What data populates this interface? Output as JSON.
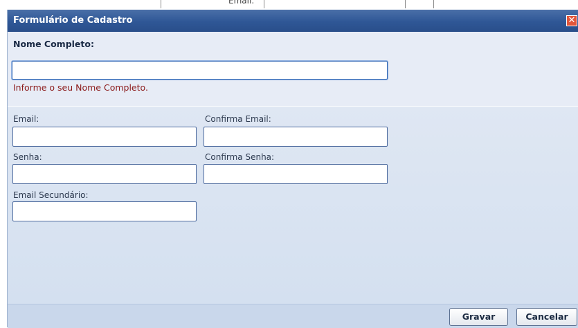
{
  "background_fragment": "Email:",
  "dialog": {
    "title": "Formulário de Cadastro",
    "close_glyph": "✕",
    "close_color": "#e2563b",
    "full_name": {
      "label": "Nome Completo:",
      "value": "",
      "error": "Informe o seu Nome Completo."
    },
    "email": {
      "label": "Email:",
      "value": ""
    },
    "confirm_email": {
      "label": "Confirma Email:",
      "value": ""
    },
    "password": {
      "label": "Senha:",
      "value": ""
    },
    "confirm_password": {
      "label": "Confirma Senha:",
      "value": ""
    },
    "secondary_email": {
      "label": "Email Secundário:",
      "value": ""
    },
    "buttons": {
      "save": "Gravar",
      "cancel": "Cancelar"
    }
  }
}
